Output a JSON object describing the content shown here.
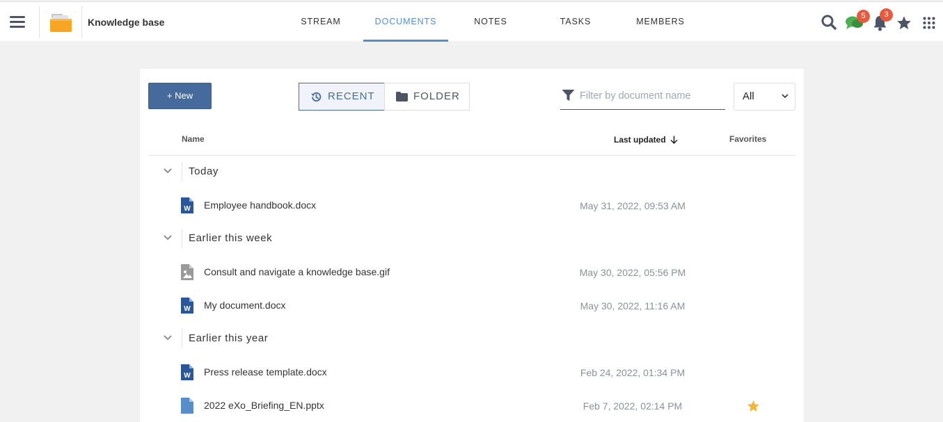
{
  "header": {
    "space_title": "Knowledge base",
    "tabs": [
      "STREAM",
      "DOCUMENTS",
      "NOTES",
      "TASKS",
      "MEMBERS"
    ],
    "active_tab": "DOCUMENTS",
    "chat_badge": "5",
    "notifications_badge": "3"
  },
  "toolbar": {
    "new_label": "New",
    "recent_label": "RECENT",
    "folder_label": "FOLDER",
    "filter_placeholder": "Filter by document name",
    "select_value": "All"
  },
  "table": {
    "col_name": "Name",
    "col_updated": "Last updated",
    "col_favorites": "Favorites"
  },
  "groups": [
    {
      "label": "Today"
    },
    {
      "label": "Earlier this week"
    },
    {
      "label": "Earlier this year"
    }
  ],
  "documents": [
    {
      "name": "Employee handbook.docx",
      "date": "May 31, 2022, 09:53 AM",
      "icon": "word-file-icon",
      "favorite": false
    },
    {
      "name": "Consult and navigate a knowledge base.gif",
      "date": "May 30, 2022, 05:56 PM",
      "icon": "image-file-icon",
      "favorite": false
    },
    {
      "name": "My document.docx",
      "date": "May 30, 2022, 11:16 AM",
      "icon": "word-file-icon",
      "favorite": false
    },
    {
      "name": "Press release template.docx",
      "date": "Feb 24, 2022, 01:34 PM",
      "icon": "word-file-icon",
      "favorite": false
    },
    {
      "name": "2022 eXo_Briefing_EN.pptx",
      "date": "Feb 7, 2022, 02:14 PM",
      "icon": "generic-file-icon",
      "favorite": true
    }
  ],
  "colors": {
    "accent": "#578dc9",
    "primary_button": "#476a9c",
    "badge": "#e85a40",
    "favorite_star": "#f4b43a",
    "word_icon": "#2b579a"
  }
}
